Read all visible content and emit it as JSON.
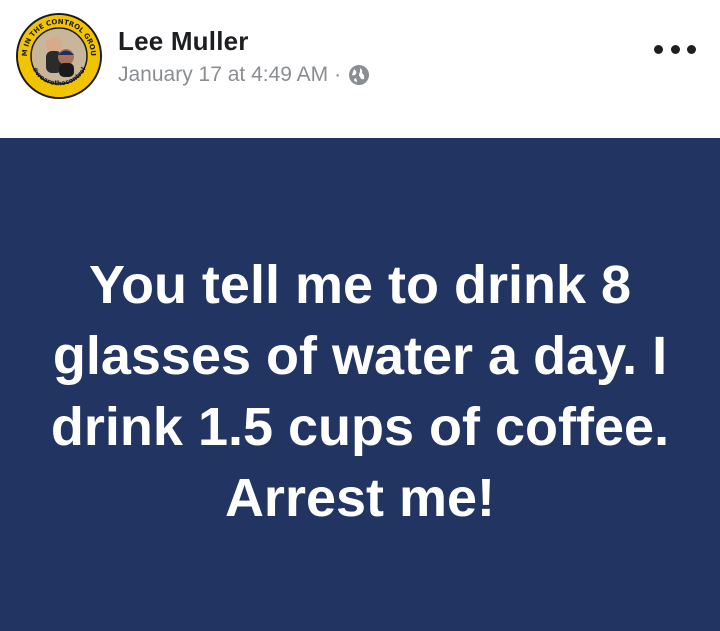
{
  "post": {
    "author": "Lee Muller",
    "date": "January 17 at 4:49 AM",
    "separator": "·",
    "privacy_icon": "globe-icon",
    "more_icon": "more-dots-icon",
    "avatar": {
      "ring_top_text": "I'M IN THE CONTROL GROUP",
      "ring_bottom_text": "#wearethecontrol"
    },
    "status_background": "#213462",
    "status_text": "You tell me to drink 8 glasses of water a day. I drink 1.5 cups of coffee. Arrest me!"
  }
}
